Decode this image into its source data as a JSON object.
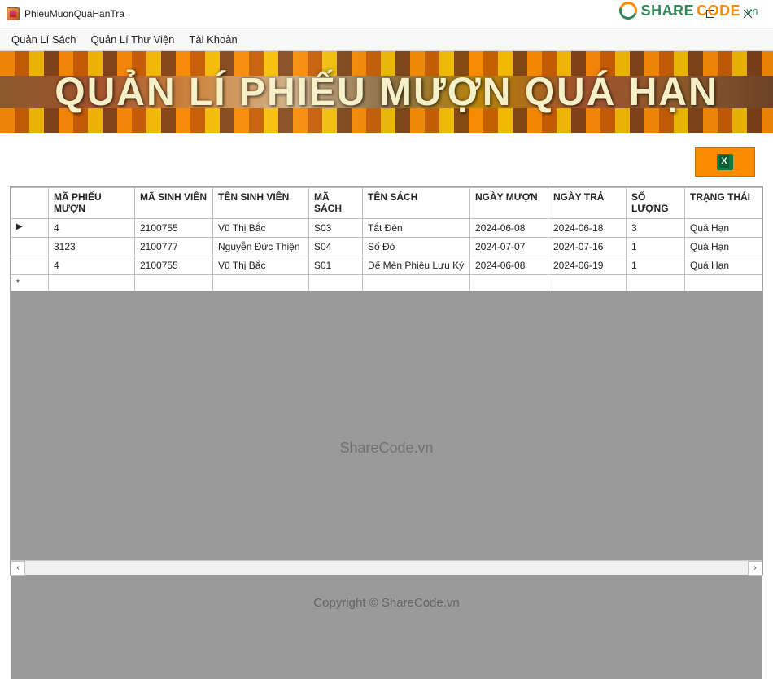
{
  "window": {
    "title": "PhieuMuonQuaHanTra"
  },
  "menu": {
    "items": [
      "Quản Lí Sách",
      "Quản Lí Thư Viện",
      "Tài Khoản"
    ]
  },
  "banner": {
    "title": "QUẢN LÍ PHIẾU MƯỢN QUÁ HẠN"
  },
  "toolbar": {
    "excel_button_name": "export-excel-button"
  },
  "grid": {
    "columns": [
      "MÃ PHIẾU MƯỢN",
      "MÃ SINH VIÊN",
      "TÊN SINH VIÊN",
      "MÃ SÁCH",
      "TÊN SÁCH",
      "NGÀY MƯỢN",
      "NGÀY TRẢ",
      "SỐ LƯỢNG",
      "TRẠNG THÁI"
    ],
    "rows": [
      {
        "ma_phieu": "4",
        "ma_sv": "2100755",
        "ten_sv": "Vũ Thị Bắc",
        "ma_sach": "S03",
        "ten_sach": "Tắt Đèn",
        "ngay_muon": "2024-06-08",
        "ngay_tra": "2024-06-18",
        "so_luong": "3",
        "trang_thai": "Quá Hạn",
        "indicator": "▶",
        "selected_col": "ma_phieu"
      },
      {
        "ma_phieu": "3123",
        "ma_sv": "2100777",
        "ten_sv": "Nguyễn Đức Thiện",
        "ma_sach": "S04",
        "ten_sach": "Số Đỏ",
        "ngay_muon": "2024-07-07",
        "ngay_tra": "2024-07-16",
        "so_luong": "1",
        "trang_thai": "Quá Hạn",
        "indicator": "",
        "selected_col": ""
      },
      {
        "ma_phieu": "4",
        "ma_sv": "2100755",
        "ten_sv": "Vũ Thị Bắc",
        "ma_sach": "S01",
        "ten_sach": "Dế Mèn Phiêu Lưu Ký",
        "ngay_muon": "2024-06-08",
        "ngay_tra": "2024-06-19",
        "so_luong": "1",
        "trang_thai": "Quá Hạn",
        "indicator": "",
        "selected_col": ""
      }
    ],
    "new_row_indicator": "*"
  },
  "watermark": {
    "center": "ShareCode.vn",
    "footer": "Copyright © ShareCode.vn"
  },
  "logo": {
    "share": "SHARE",
    "code": "CODE",
    "vn": ".vn"
  }
}
